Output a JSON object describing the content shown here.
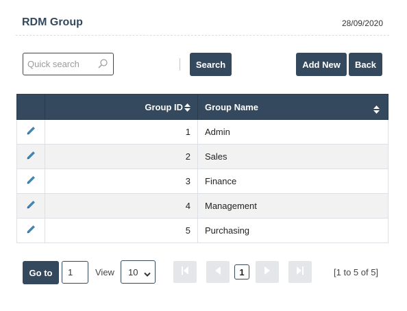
{
  "header": {
    "title": "RDM Group",
    "date": "28/09/2020"
  },
  "toolbar": {
    "search_placeholder": "Quick search",
    "search_label": "Search",
    "add_label": "Add New",
    "back_label": "Back"
  },
  "table": {
    "columns": [
      "Group ID",
      "Group Name"
    ],
    "rows": [
      {
        "id": "1",
        "name": "Admin"
      },
      {
        "id": "2",
        "name": "Sales"
      },
      {
        "id": "3",
        "name": "Finance"
      },
      {
        "id": "4",
        "name": "Management"
      },
      {
        "id": "5",
        "name": "Purchasing"
      }
    ]
  },
  "pager": {
    "goto_label": "Go to",
    "goto_value": "1",
    "view_label": "View",
    "view_value": "10",
    "current_page": "1",
    "info": "[1 to 5 of 5]"
  },
  "colors": {
    "primary": "#34495e",
    "row_alt": "#f2f2f2",
    "pencil": "#3f88b5",
    "pager_disabled": "#e4e6e9"
  },
  "icons": {
    "search": "search-icon",
    "edit": "pencil-icon",
    "sort": "sort-icon",
    "first": "first-page-icon",
    "prev": "prev-page-icon",
    "next": "next-page-icon",
    "last": "last-page-icon"
  }
}
